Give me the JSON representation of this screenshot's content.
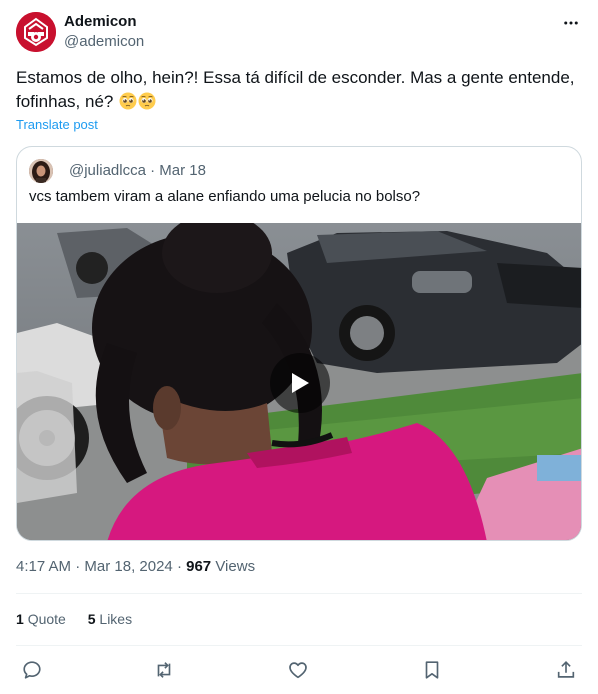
{
  "author": {
    "name": "Ademicon",
    "handle": "@ademicon"
  },
  "tweet": {
    "text_line1": "Estamos de olho, hein?! Essa tá difícil de esconder. Mas a gente entende,",
    "text_line2": "fofinhas, né?",
    "translate_label": "Translate post"
  },
  "quoted": {
    "handle": "@juliadlcca",
    "separator": "·",
    "date": "Mar 18",
    "text": "vcs tambem viram a alane enfiando uma pelucia no bolso?"
  },
  "meta": {
    "time": "4:17 AM",
    "date": "Mar 18, 2024",
    "dot": "·",
    "views_count": "967",
    "views_label": "Views"
  },
  "stats": {
    "quotes_count": "1",
    "quotes_label": "Quote",
    "likes_count": "5",
    "likes_label": "Likes"
  },
  "icons": {
    "more": "more-horizontal-icon",
    "reply": "reply-icon",
    "repost": "repost-icon",
    "like": "heart-icon",
    "bookmark": "bookmark-icon",
    "share": "share-icon",
    "play": "play-icon"
  },
  "colors": {
    "brand": "#c8102e",
    "link": "#1d9bf0",
    "muted": "#536471",
    "text": "#0f1419",
    "border": "#cfd9de"
  }
}
